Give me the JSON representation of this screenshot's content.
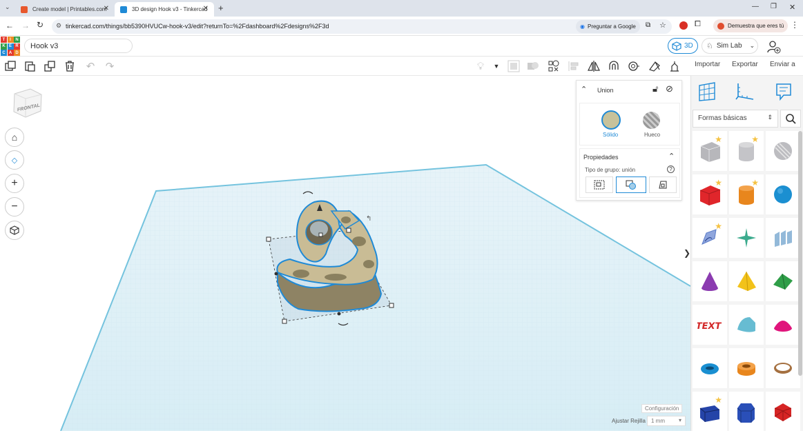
{
  "browser": {
    "tabs": [
      {
        "title": "Create model | Printables.com",
        "active": false
      },
      {
        "title": "3D design Hook v3 - Tinkercad",
        "active": true
      }
    ],
    "url": "tinkercad.com/things/bb5390HVUCw-hook-v3/edit?returnTo=%2Fdashboard%2Fdesigns%2F3d",
    "ask_google": "Preguntar a Google",
    "profile_prompt": "Demuestra que eres tú"
  },
  "app": {
    "logo_letters": [
      "T",
      "I",
      "N",
      "K",
      "E",
      "R",
      "C",
      "A",
      "D"
    ],
    "design_title": "Hook v3",
    "mode_label": "3D",
    "workspace": "Sim Lab"
  },
  "toolbar_right": {
    "import": "Importar",
    "export": "Exportar",
    "send": "Enviar a"
  },
  "viewcube": {
    "label": "FRONTAL"
  },
  "inspector": {
    "title": "Union",
    "solid_label": "Sólido",
    "hole_label": "Hueco",
    "properties_label": "Propiedades",
    "group_type_label": "Tipo de grupo: unión",
    "help": "?"
  },
  "shapes_panel": {
    "category": "Formas básicas",
    "shapes": [
      {
        "name": "box-hole",
        "color": "#b7b7bb",
        "star": true
      },
      {
        "name": "cylinder-hole",
        "color": "#c4c4c8",
        "star": true
      },
      {
        "name": "sphere-hole",
        "color": "#bcbcc0",
        "star": false
      },
      {
        "name": "box",
        "color": "#e0262b",
        "star": true
      },
      {
        "name": "cylinder",
        "color": "#e8861d",
        "star": true
      },
      {
        "name": "sphere",
        "color": "#1b8fd1",
        "star": false
      },
      {
        "name": "scribble",
        "color": "#5a7bc8",
        "star": true
      },
      {
        "name": "star",
        "color": "#3cab8e",
        "star": false
      },
      {
        "name": "text",
        "color": "#93b9d9",
        "star": false
      },
      {
        "name": "cone",
        "color": "#8b3bb0",
        "star": false
      },
      {
        "name": "pyramid",
        "color": "#f2c21a",
        "star": false
      },
      {
        "name": "roof",
        "color": "#2f9e48",
        "star": false
      },
      {
        "name": "text-3d",
        "color": "#d32a2a",
        "star": false
      },
      {
        "name": "half-cylinder",
        "color": "#67bcd2",
        "star": false
      },
      {
        "name": "paraboloid",
        "color": "#e0157c",
        "star": false
      },
      {
        "name": "torus",
        "color": "#1a8fd1",
        "star": false
      },
      {
        "name": "tube",
        "color": "#e8861d",
        "star": false
      },
      {
        "name": "ring",
        "color": "#a57040",
        "star": false
      },
      {
        "name": "wedge",
        "color": "#2544a8",
        "star": true
      },
      {
        "name": "polygon",
        "color": "#2a4fb8",
        "star": false
      },
      {
        "name": "icosahedron",
        "color": "#d62424",
        "star": false
      }
    ]
  },
  "footer": {
    "settings": "Configuración",
    "snap_label": "Ajustar Rejilla",
    "snap_value": "1 mm"
  },
  "colors": {
    "accent": "#1f8ad6",
    "part_fill": "#c9bc95",
    "grid": "#c9e3ef"
  }
}
